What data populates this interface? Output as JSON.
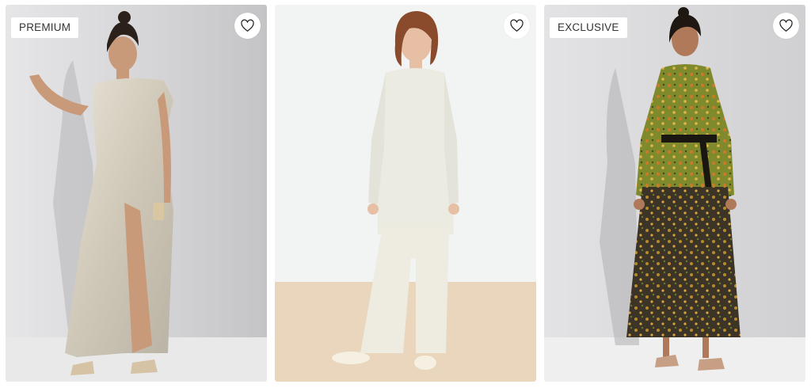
{
  "products": [
    {
      "badge": "PREMIUM",
      "favorite_icon": "heart-outline-icon"
    },
    {
      "badge": "",
      "favorite_icon": "heart-outline-icon"
    },
    {
      "badge": "EXCLUSIVE",
      "favorite_icon": "heart-outline-icon"
    }
  ],
  "colors": {
    "studio_grey": "#d9d9db",
    "cream": "#f1ede4",
    "floor_beige": "#e9d6bc",
    "silver_dress": "#d7d1c4",
    "olive_print": "#7f8a2c",
    "dark_skirt": "#3c3426"
  }
}
